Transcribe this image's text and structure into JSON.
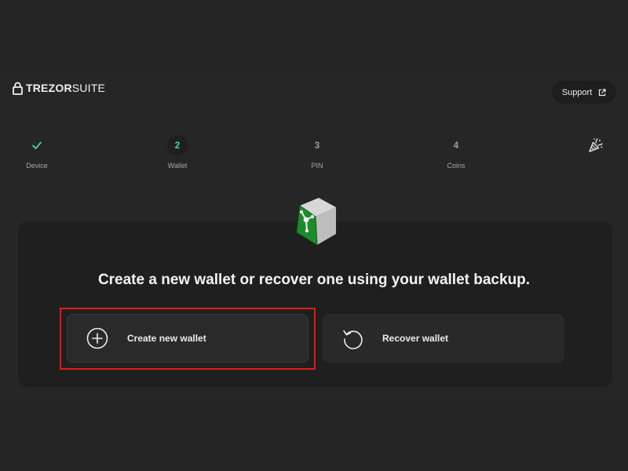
{
  "header": {
    "logo_brand": "TREZOR",
    "logo_product": "SUITE",
    "support_label": "Support",
    "logo_icon": "lock-icon",
    "support_icon": "external-link-icon"
  },
  "stepper": {
    "steps": [
      {
        "marker": "✓",
        "label": "Device",
        "state": "completed"
      },
      {
        "marker": "2",
        "label": "Wallet",
        "state": "active"
      },
      {
        "marker": "3",
        "label": "PIN",
        "state": "upcoming"
      },
      {
        "marker": "4",
        "label": "Coins",
        "state": "upcoming"
      }
    ],
    "final_icon": "party-popper-icon"
  },
  "main": {
    "hero_icon": "wallet-cube-icon",
    "headline": "Create a new wallet or recover one using your wallet backup.",
    "options": [
      {
        "label": "Create new wallet",
        "icon": "plus-circle-icon"
      },
      {
        "label": "Recover wallet",
        "icon": "recover-icon"
      }
    ]
  },
  "colors": {
    "accent_green": "#4fd1a5",
    "highlight_red": "#e01a1a"
  }
}
